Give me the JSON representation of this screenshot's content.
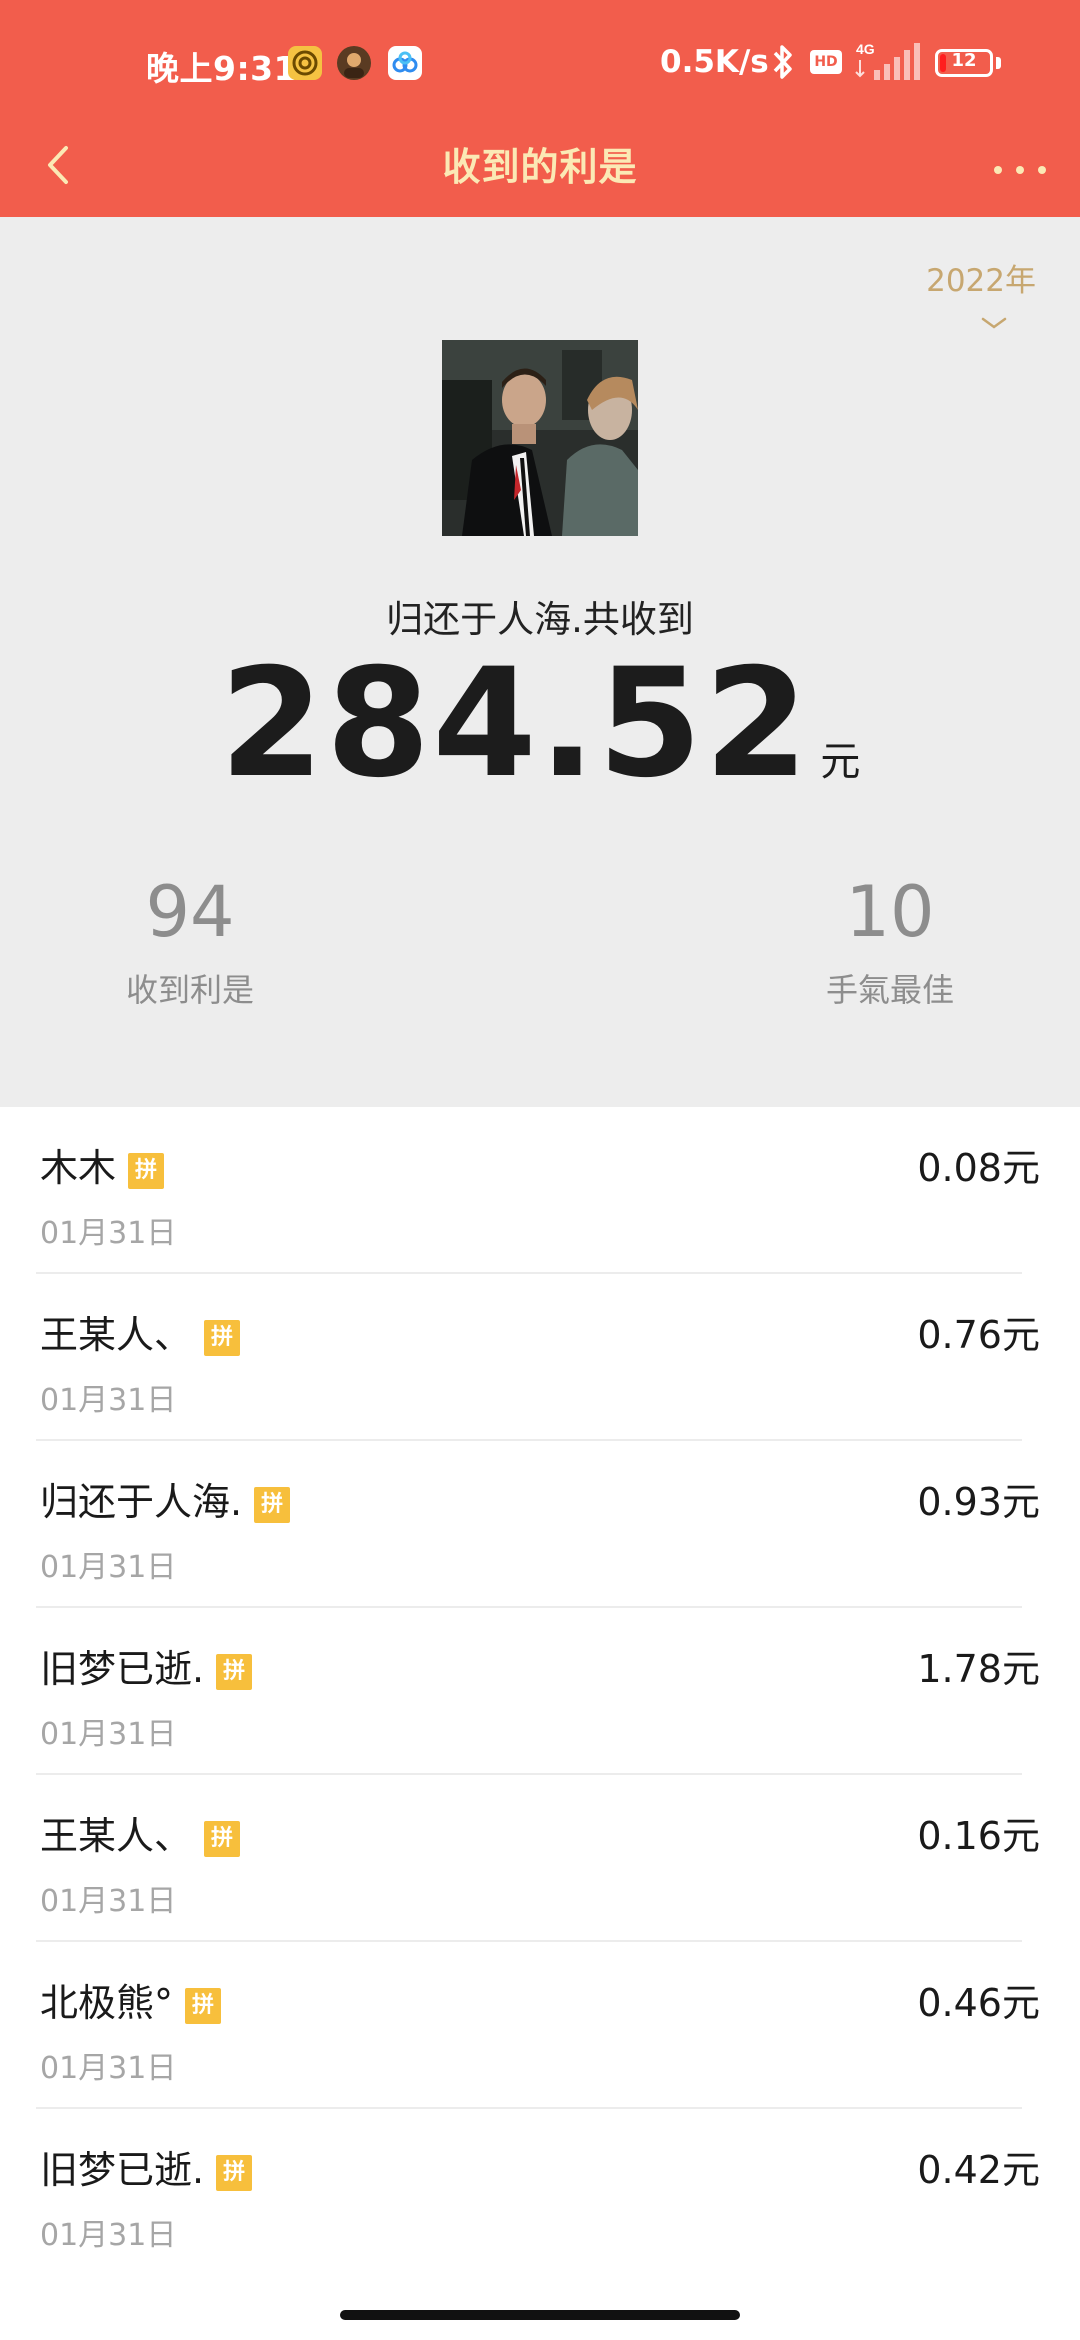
{
  "status_bar": {
    "time": "晚上9:31",
    "net_speed": "0.5K/s",
    "hd": "HD",
    "network": "4G",
    "battery": "12",
    "battery_level": 0.12,
    "app_icons": [
      "target-app-icon",
      "avatar-app-icon",
      "cloud-app-icon"
    ]
  },
  "nav": {
    "title": "收到的利是",
    "back_icon": "chevron-left-icon",
    "more_icon": "more-dots-icon"
  },
  "summary": {
    "year": "2022年",
    "user_label": "归还于人海.共收到",
    "amount": "284.52",
    "amount_unit": "元",
    "count_value": "94",
    "count_label": "收到利是",
    "best_value": "10",
    "best_label": "手氣最佳"
  },
  "records": [
    {
      "name": "木木",
      "badge": "拼",
      "date": "01月31日",
      "amount": "0.08元"
    },
    {
      "name": "王某人、",
      "badge": "拼",
      "date": "01月31日",
      "amount": "0.76元"
    },
    {
      "name": "归还于人海.",
      "badge": "拼",
      "date": "01月31日",
      "amount": "0.93元"
    },
    {
      "name": "旧梦已逝.",
      "badge": "拼",
      "date": "01月31日",
      "amount": "1.78元"
    },
    {
      "name": "王某人、",
      "badge": "拼",
      "date": "01月31日",
      "amount": "0.16元"
    },
    {
      "name": "北极熊°",
      "badge": "拼",
      "date": "01月31日",
      "amount": "0.46元"
    },
    {
      "name": "旧梦已逝.",
      "badge": "拼",
      "date": "01月31日",
      "amount": "0.42元"
    }
  ],
  "colors": {
    "header_bg": "#f25d4c",
    "title_gold": "#fbe9b5",
    "year_gold": "#c7a770",
    "badge_yellow": "#f7bf3c"
  }
}
